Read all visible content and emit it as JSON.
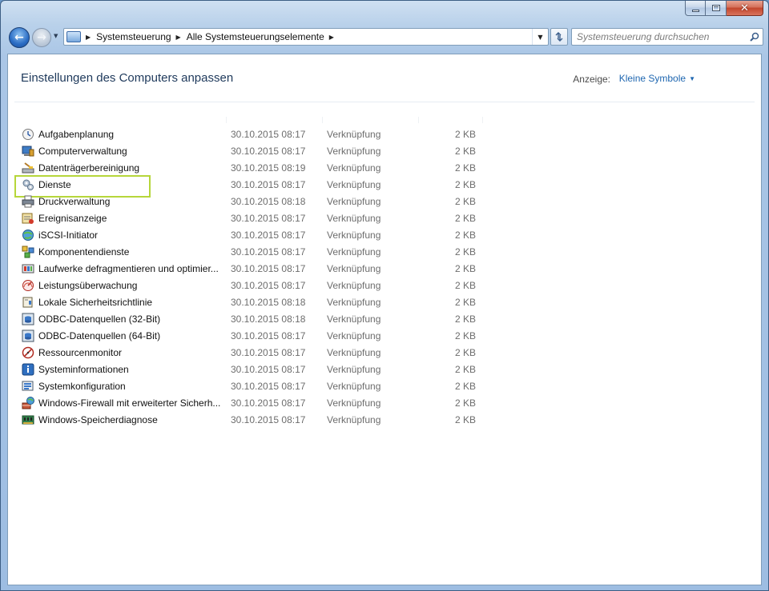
{
  "window": {
    "controls": {
      "minimize": "–",
      "maximize": "□",
      "close": "✕"
    }
  },
  "nav": {
    "back_icon": "←",
    "forward_icon": "→",
    "breadcrumbs": [
      "Systemsteuerung",
      "Alle Systemsteuerungselemente"
    ],
    "search_placeholder": "Systemsteuerung durchsuchen"
  },
  "header": {
    "title": "Einstellungen des Computers anpassen",
    "view_label": "Anzeige:",
    "view_value": "Kleine Symbole"
  },
  "colors": {
    "highlight_border": "#b6d63a",
    "title_color": "#1e395b",
    "link_color": "#1e66b0"
  },
  "items": [
    {
      "name": "Aufgabenplanung",
      "date": "30.10.2015 08:17",
      "type": "Verknüpfung",
      "size": "2 KB",
      "icon": "clock-icon"
    },
    {
      "name": "Computerverwaltung",
      "date": "30.10.2015 08:17",
      "type": "Verknüpfung",
      "size": "2 KB",
      "icon": "computer-management-icon"
    },
    {
      "name": "Datenträgerbereinigung",
      "date": "30.10.2015 08:19",
      "type": "Verknüpfung",
      "size": "2 KB",
      "icon": "disk-cleanup-icon"
    },
    {
      "name": "Dienste",
      "date": "30.10.2015 08:17",
      "type": "Verknüpfung",
      "size": "2 KB",
      "icon": "gears-icon",
      "highlighted": true
    },
    {
      "name": "Druckverwaltung",
      "date": "30.10.2015 08:18",
      "type": "Verknüpfung",
      "size": "2 KB",
      "icon": "printer-icon"
    },
    {
      "name": "Ereignisanzeige",
      "date": "30.10.2015 08:17",
      "type": "Verknüpfung",
      "size": "2 KB",
      "icon": "event-viewer-icon"
    },
    {
      "name": "iSCSI-Initiator",
      "date": "30.10.2015 08:17",
      "type": "Verknüpfung",
      "size": "2 KB",
      "icon": "globe-icon"
    },
    {
      "name": "Komponentendienste",
      "date": "30.10.2015 08:17",
      "type": "Verknüpfung",
      "size": "2 KB",
      "icon": "component-services-icon"
    },
    {
      "name": "Laufwerke defragmentieren und optimier...",
      "date": "30.10.2015 08:17",
      "type": "Verknüpfung",
      "size": "2 KB",
      "icon": "defrag-icon"
    },
    {
      "name": "Leistungsüberwachung",
      "date": "30.10.2015 08:17",
      "type": "Verknüpfung",
      "size": "2 KB",
      "icon": "gauge-icon"
    },
    {
      "name": "Lokale Sicherheitsrichtlinie",
      "date": "30.10.2015 08:18",
      "type": "Verknüpfung",
      "size": "2 KB",
      "icon": "security-policy-icon"
    },
    {
      "name": "ODBC-Datenquellen (32-Bit)",
      "date": "30.10.2015 08:18",
      "type": "Verknüpfung",
      "size": "2 KB",
      "icon": "odbc-icon"
    },
    {
      "name": "ODBC-Datenquellen (64-Bit)",
      "date": "30.10.2015 08:17",
      "type": "Verknüpfung",
      "size": "2 KB",
      "icon": "odbc-icon"
    },
    {
      "name": "Ressourcenmonitor",
      "date": "30.10.2015 08:17",
      "type": "Verknüpfung",
      "size": "2 KB",
      "icon": "resource-monitor-icon"
    },
    {
      "name": "Systeminformationen",
      "date": "30.10.2015 08:17",
      "type": "Verknüpfung",
      "size": "2 KB",
      "icon": "system-info-icon"
    },
    {
      "name": "Systemkonfiguration",
      "date": "30.10.2015 08:17",
      "type": "Verknüpfung",
      "size": "2 KB",
      "icon": "system-config-icon"
    },
    {
      "name": "Windows-Firewall mit erweiterter Sicherh...",
      "date": "30.10.2015 08:17",
      "type": "Verknüpfung",
      "size": "2 KB",
      "icon": "firewall-icon"
    },
    {
      "name": "Windows-Speicherdiagnose",
      "date": "30.10.2015 08:17",
      "type": "Verknüpfung",
      "size": "2 KB",
      "icon": "memory-diagnostic-icon"
    }
  ]
}
